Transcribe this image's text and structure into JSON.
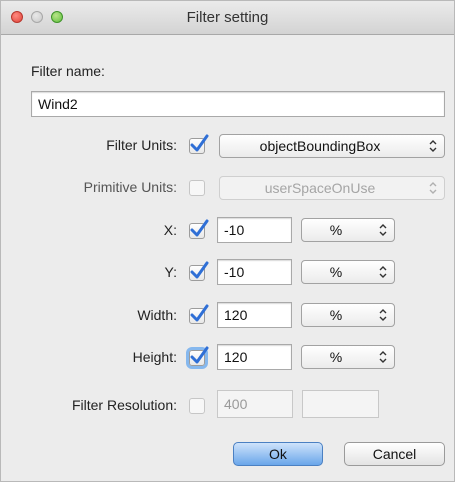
{
  "window": {
    "title": "Filter setting"
  },
  "filter_name": {
    "label": "Filter name:",
    "value": "Wind2"
  },
  "filter_units": {
    "label": "Filter Units:",
    "checked": true,
    "selected": "objectBoundingBox"
  },
  "primitive_units": {
    "label": "Primitive Units:",
    "checked": false,
    "selected": "userSpaceOnUse"
  },
  "x": {
    "label": "X:",
    "checked": true,
    "value": "-10",
    "unit": "%"
  },
  "y": {
    "label": "Y:",
    "checked": true,
    "value": "-10",
    "unit": "%"
  },
  "width": {
    "label": "Width:",
    "checked": true,
    "value": "120",
    "unit": "%"
  },
  "height": {
    "label": "Height:",
    "checked": true,
    "value": "120",
    "unit": "%"
  },
  "filter_resolution": {
    "label": "Filter Resolution:",
    "checked": false,
    "value_x": "400",
    "value_y": ""
  },
  "buttons": {
    "ok": "Ok",
    "cancel": "Cancel"
  },
  "colors": {
    "accent": "#2f6fd6",
    "default_button": "#6aa6ea",
    "focus_ring": "#86b8ee"
  },
  "icons": {
    "checkbox_checked": "checkmark-icon",
    "select": "updown-arrows-icon"
  }
}
